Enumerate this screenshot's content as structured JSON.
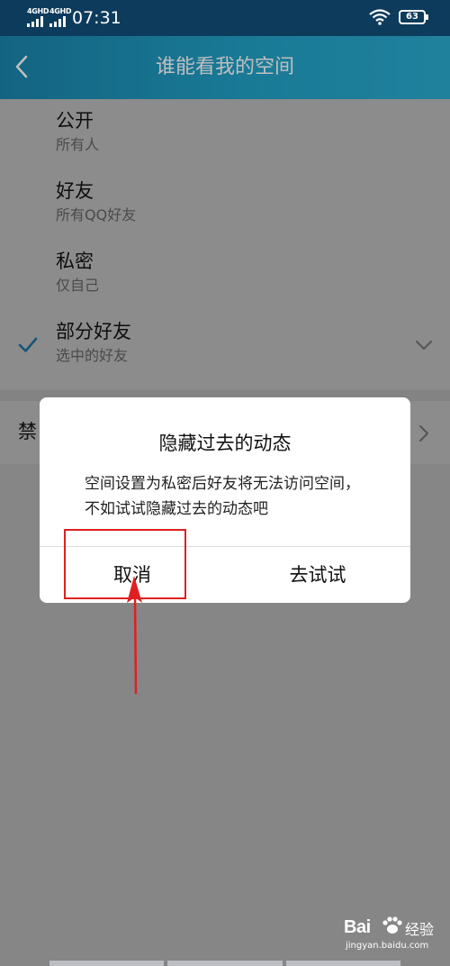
{
  "status_bar": {
    "network_1": "4GHD",
    "network_2": "4GHD",
    "time": "07:31",
    "battery": "63"
  },
  "header": {
    "title": "谁能看我的空间"
  },
  "options": [
    {
      "title": "公开",
      "subtitle": "所有人",
      "checked": false
    },
    {
      "title": "好友",
      "subtitle": "所有QQ好友",
      "checked": false
    },
    {
      "title": "私密",
      "subtitle": "仅自己",
      "checked": false
    },
    {
      "title": "部分好友",
      "subtitle": "选中的好友",
      "checked": true
    }
  ],
  "ban_item": {
    "title_visible": "禁"
  },
  "dialog": {
    "title": "隐藏过去的动态",
    "message": "空间设置为私密后好友将无法访问空间，不如试试隐藏过去的动态吧",
    "cancel_label": "取消",
    "confirm_label": "去试试"
  },
  "annotation": {
    "color": "#e02020"
  },
  "watermark": {
    "logo": "Bai",
    "brand": "经验",
    "url": "jingyan.baidu.com"
  },
  "colors": {
    "accent": "#1e8fc0",
    "check": "#2a9ad6"
  }
}
